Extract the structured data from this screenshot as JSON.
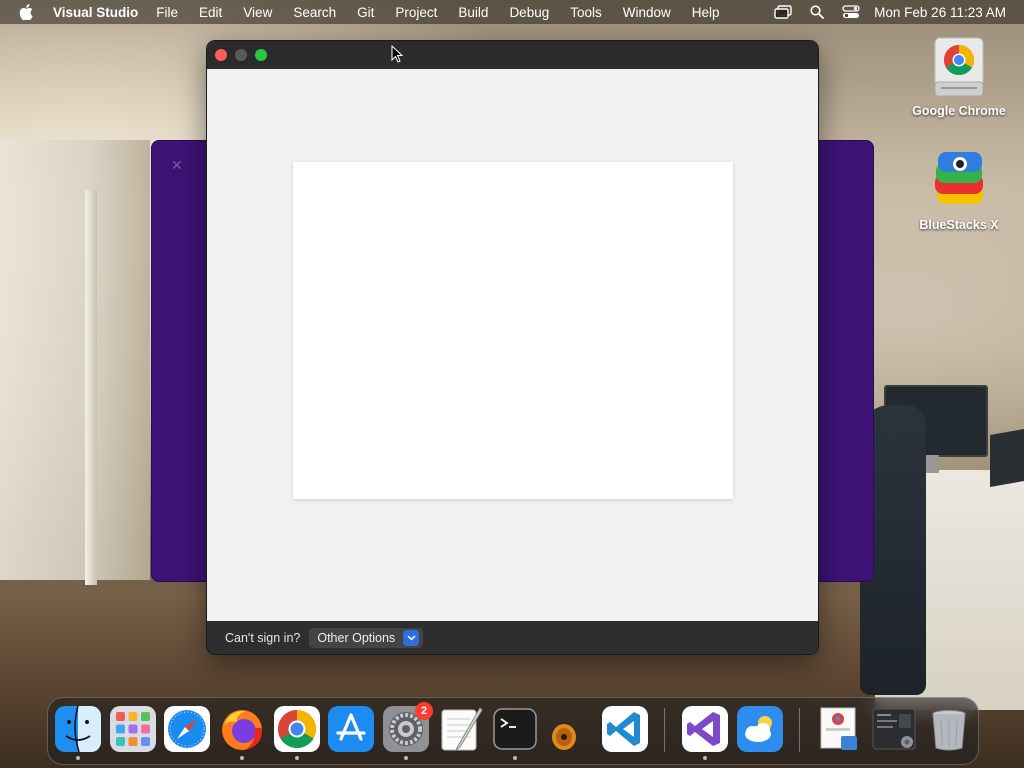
{
  "menubar": {
    "app_name": "Visual Studio",
    "items": [
      "File",
      "Edit",
      "View",
      "Search",
      "Git",
      "Project",
      "Build",
      "Debug",
      "Tools",
      "Window",
      "Help"
    ],
    "clock": "Mon Feb 26  11:23 AM",
    "status_icons": [
      "display-icon",
      "spotlight-search-icon",
      "control-center-icon"
    ]
  },
  "desktop_icons": [
    {
      "label": "Google Chrome",
      "icon": "chrome-drive-icon"
    },
    {
      "label": "BlueStacks X",
      "icon": "bluestacks-icon"
    }
  ],
  "window": {
    "footer": {
      "cant_sign_in": "Can't sign in?",
      "other_options": "Other Options"
    }
  },
  "dock": {
    "apps": [
      {
        "name": "Finder",
        "icon": "finder-icon",
        "running": true
      },
      {
        "name": "Launchpad",
        "icon": "launchpad-icon",
        "running": false
      },
      {
        "name": "Safari",
        "icon": "safari-icon",
        "running": false
      },
      {
        "name": "Firefox",
        "icon": "firefox-icon",
        "running": true
      },
      {
        "name": "Google Chrome",
        "icon": "chrome-icon",
        "running": true
      },
      {
        "name": "App Store",
        "icon": "app-store-icon",
        "running": false
      },
      {
        "name": "System Settings",
        "icon": "settings-icon",
        "running": true,
        "badge": "2"
      },
      {
        "name": "TextEdit",
        "icon": "textedit-icon",
        "running": false
      },
      {
        "name": "Terminal",
        "icon": "terminal-icon",
        "running": true
      },
      {
        "name": "GarageBand",
        "icon": "garageband-icon",
        "running": false
      },
      {
        "name": "Visual Studio Code",
        "icon": "vscode-icon",
        "running": false
      },
      {
        "name": "Visual Studio",
        "icon": "visual-studio-icon",
        "running": true
      },
      {
        "name": "Weather",
        "icon": "weather-icon",
        "running": false
      },
      {
        "name": "Downloads",
        "icon": "downloads-stack-icon",
        "running": false
      },
      {
        "name": "Recent Window",
        "icon": "window-stack-icon",
        "running": false
      },
      {
        "name": "Trash",
        "icon": "trash-icon",
        "running": false
      }
    ]
  }
}
